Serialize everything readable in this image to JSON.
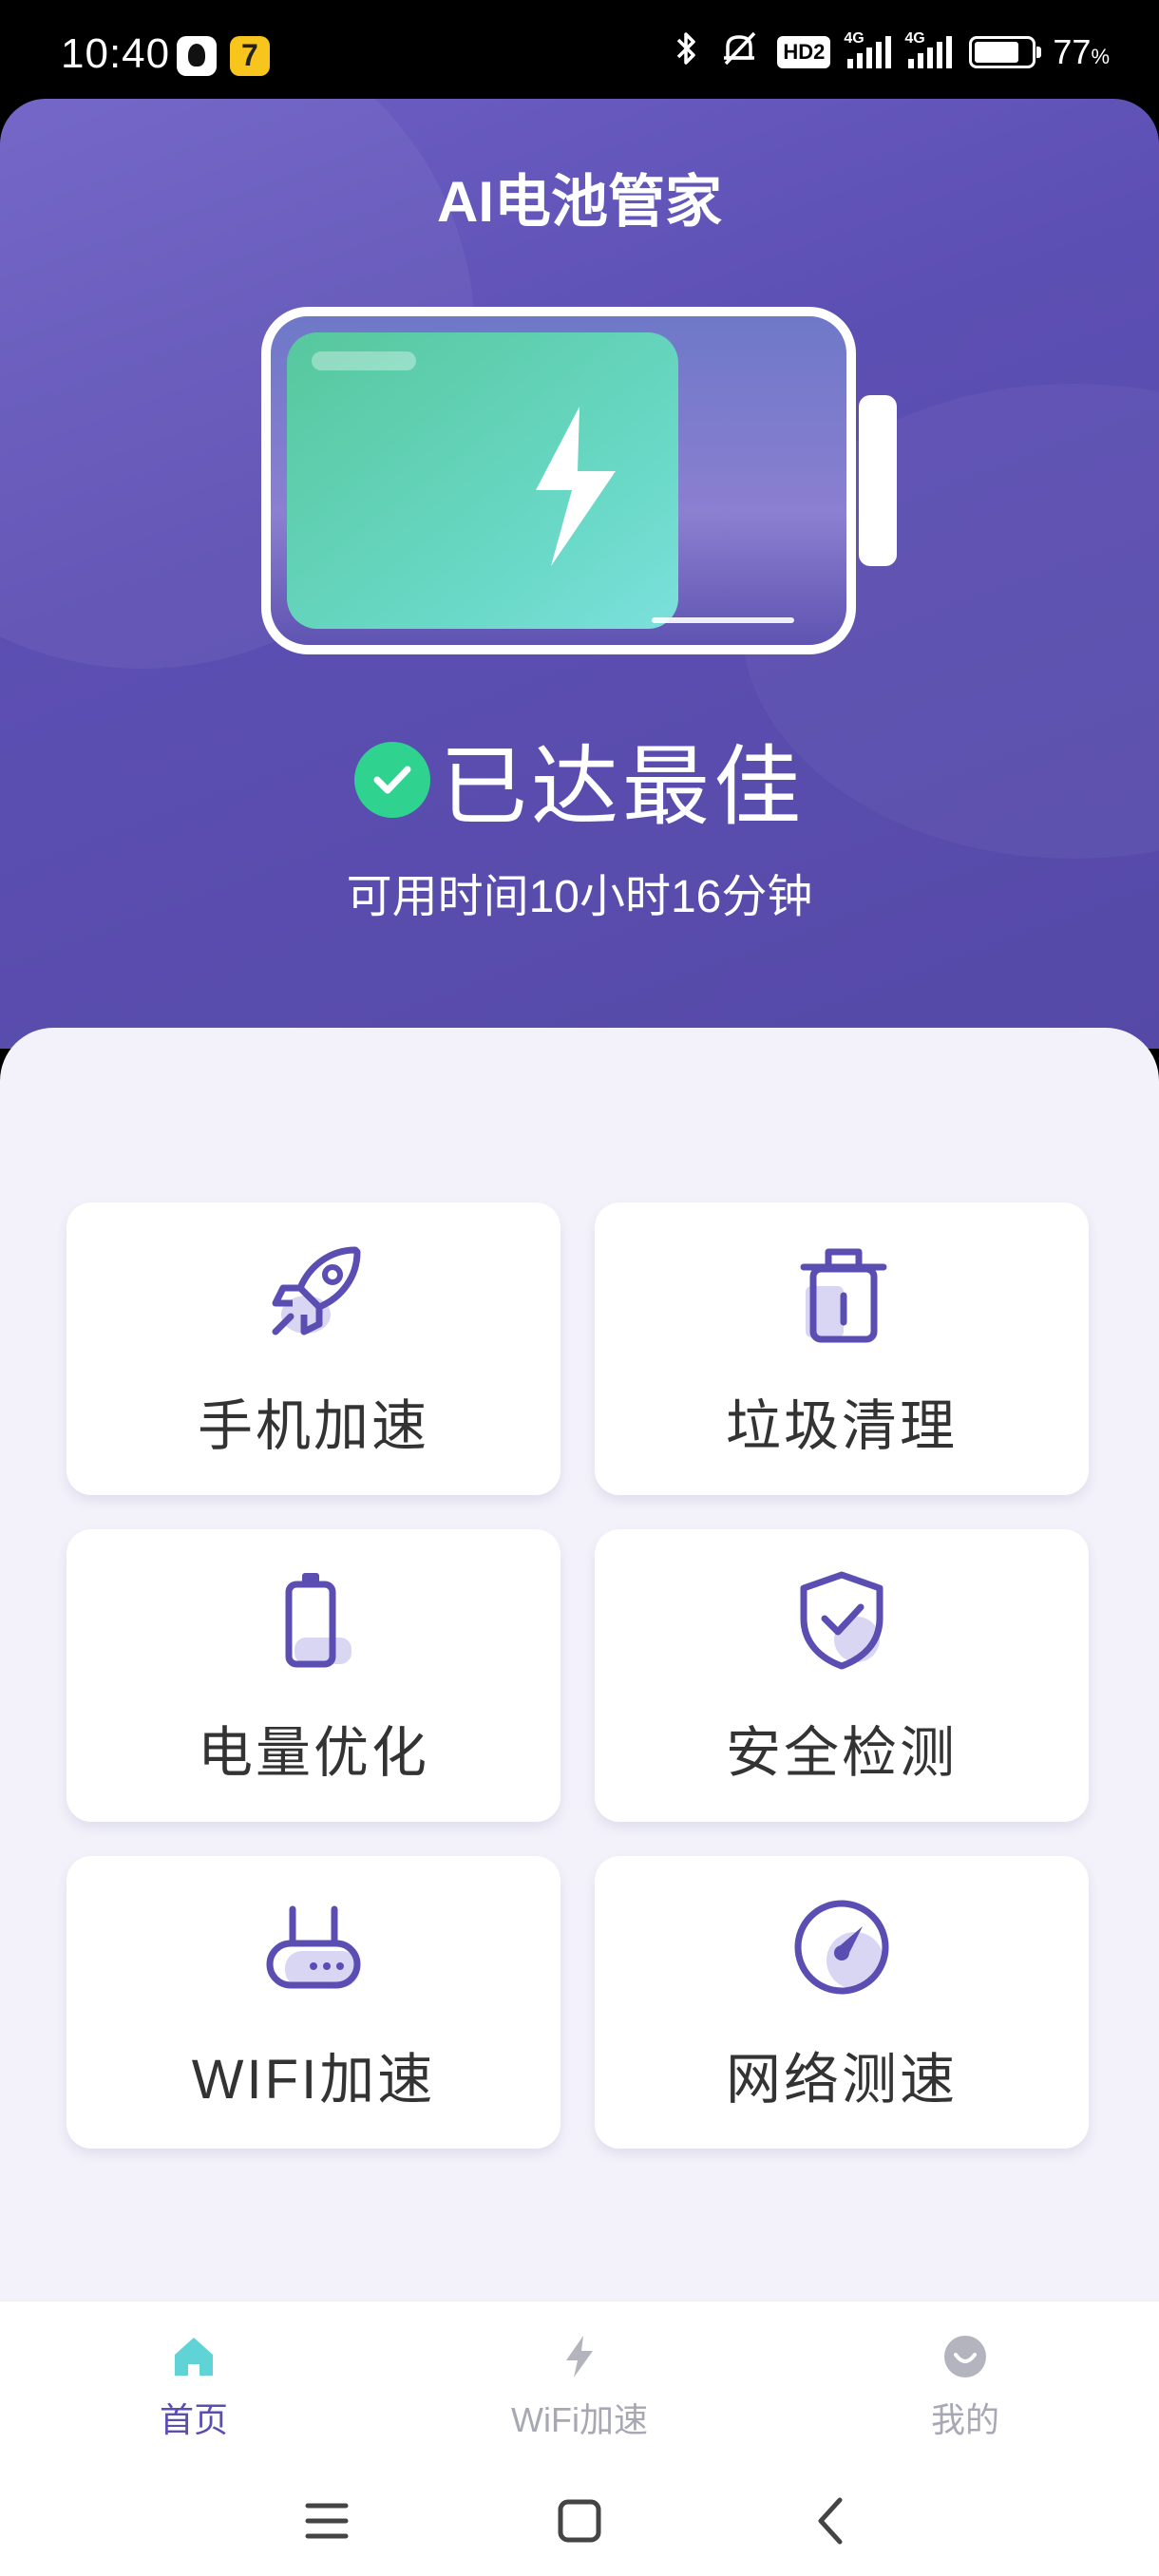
{
  "status_bar": {
    "time": "10:40",
    "network_1": "4G",
    "network_2": "4G",
    "hd_badge": "HD2",
    "battery_percent": "77",
    "battery_percent_unit": "%"
  },
  "header": {
    "title": "AI电池管家",
    "status": "已达最佳",
    "usable_time": "可用时间10小时16分钟",
    "battery_level": 0.72
  },
  "features": [
    {
      "label": "手机加速",
      "icon": "rocket-icon"
    },
    {
      "label": "垃圾清理",
      "icon": "trash-icon"
    },
    {
      "label": "电量优化",
      "icon": "battery-icon"
    },
    {
      "label": "安全检测",
      "icon": "shield-check-icon"
    },
    {
      "label": "WIFI加速",
      "icon": "router-icon"
    },
    {
      "label": "网络测速",
      "icon": "speedometer-icon"
    }
  ],
  "tabs": [
    {
      "label": "首页",
      "icon": "home-icon",
      "active": true
    },
    {
      "label": "WiFi加速",
      "icon": "lightning-icon",
      "active": false
    },
    {
      "label": "我的",
      "icon": "smiley-icon",
      "active": false
    }
  ],
  "colors": {
    "header_bg": "#5c4fb3",
    "accent": "#5a4eb3",
    "battery_fill": "#4fd0a8",
    "check": "#2fd28f",
    "tab_active_icon": "#5fd3d6"
  }
}
